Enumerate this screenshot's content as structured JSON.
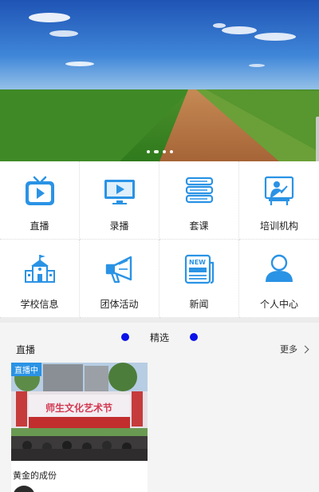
{
  "banner": {
    "slides": 4,
    "active_slide": 1,
    "dots": [
      "",
      "",
      "",
      ""
    ]
  },
  "menu": [
    {
      "label": "直播",
      "icon": "live-tv-icon"
    },
    {
      "label": "录播",
      "icon": "recorded-video-icon"
    },
    {
      "label": "套课",
      "icon": "course-stack-icon"
    },
    {
      "label": "培训机构",
      "icon": "training-institution-icon"
    },
    {
      "label": "学校信息",
      "icon": "school-building-icon"
    },
    {
      "label": "团体活动",
      "icon": "megaphone-icon"
    },
    {
      "label": "新闻",
      "icon": "news-icon"
    },
    {
      "label": "个人中心",
      "icon": "user-profile-icon"
    }
  ],
  "featured": {
    "title": "精选",
    "section_label": "直播",
    "more_label": "更多",
    "card": {
      "badge": "直播中",
      "title": "黄金的成份",
      "image_banner_text": "师生文化艺术节"
    }
  },
  "colors": {
    "accent": "#2a93e5",
    "indicator": "#0b12e8"
  }
}
